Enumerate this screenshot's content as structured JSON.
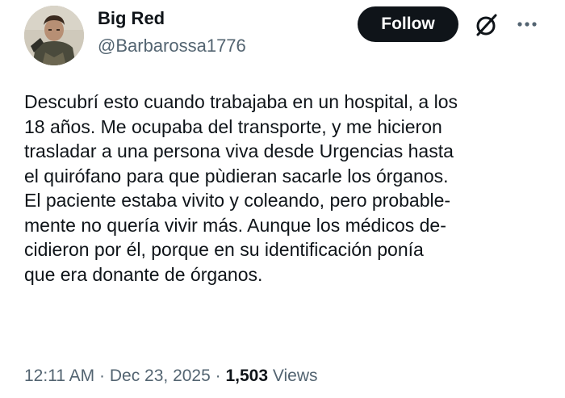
{
  "author": {
    "display_name": "Big Red",
    "handle": "@Barbarossa1776"
  },
  "actions": {
    "follow_label": "Follow",
    "grok_icon": "grok-icon",
    "more_icon": "more-options-icon"
  },
  "tweet": {
    "lines": [
      "Descubrí esto cuando trabajaba en un hospital, a los",
      "18 años. Me ocupaba del transporte, y me hicieron",
      "trasladar a una persona viva desde Urgencias hasta",
      "el quirófano para que pùdieran sacarle los órganos.",
      "El paciente estaba vivito y coleando, pero probable-",
      "mente no quería vivir más. Aunque los médicos de-",
      "cidieron por él, porque en su identificación ponía",
      "que era donante de órganos."
    ]
  },
  "meta": {
    "time": "12:11 AM",
    "separator": "·",
    "date": "Dec 23, 2025",
    "views_count": "1,503",
    "views_label": "Views"
  },
  "colors": {
    "text": "#0f1419",
    "secondary": "#536471",
    "button_bg": "#0f1419",
    "button_text": "#ffffff"
  }
}
